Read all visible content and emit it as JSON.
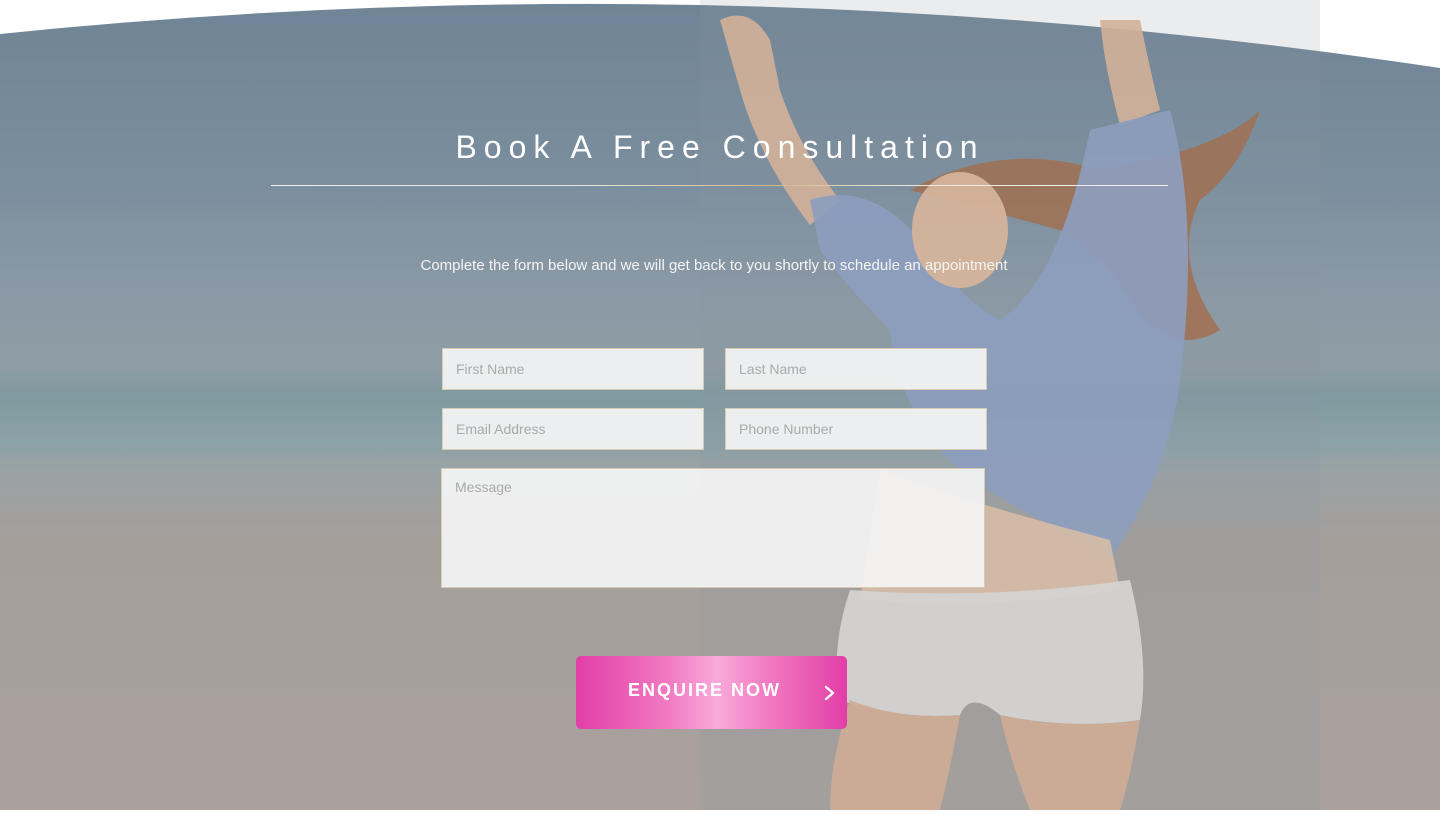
{
  "section": {
    "title": "Book A Free Consultation",
    "subtitle": "Complete the form below and we will get back to you shortly to schedule an appointment"
  },
  "form": {
    "first_name_placeholder": "First Name",
    "last_name_placeholder": "Last Name",
    "email_placeholder": "Email Address",
    "phone_placeholder": "Phone Number",
    "message_placeholder": "Message",
    "submit_label": "ENQUIRE NOW",
    "submit_icon": "chevron-right-icon"
  },
  "colors": {
    "button_gradient_start": "#e23ea7",
    "button_gradient_mid": "#f9aadc",
    "divider_accent": "#cfb68a",
    "text": "#ffffff"
  }
}
